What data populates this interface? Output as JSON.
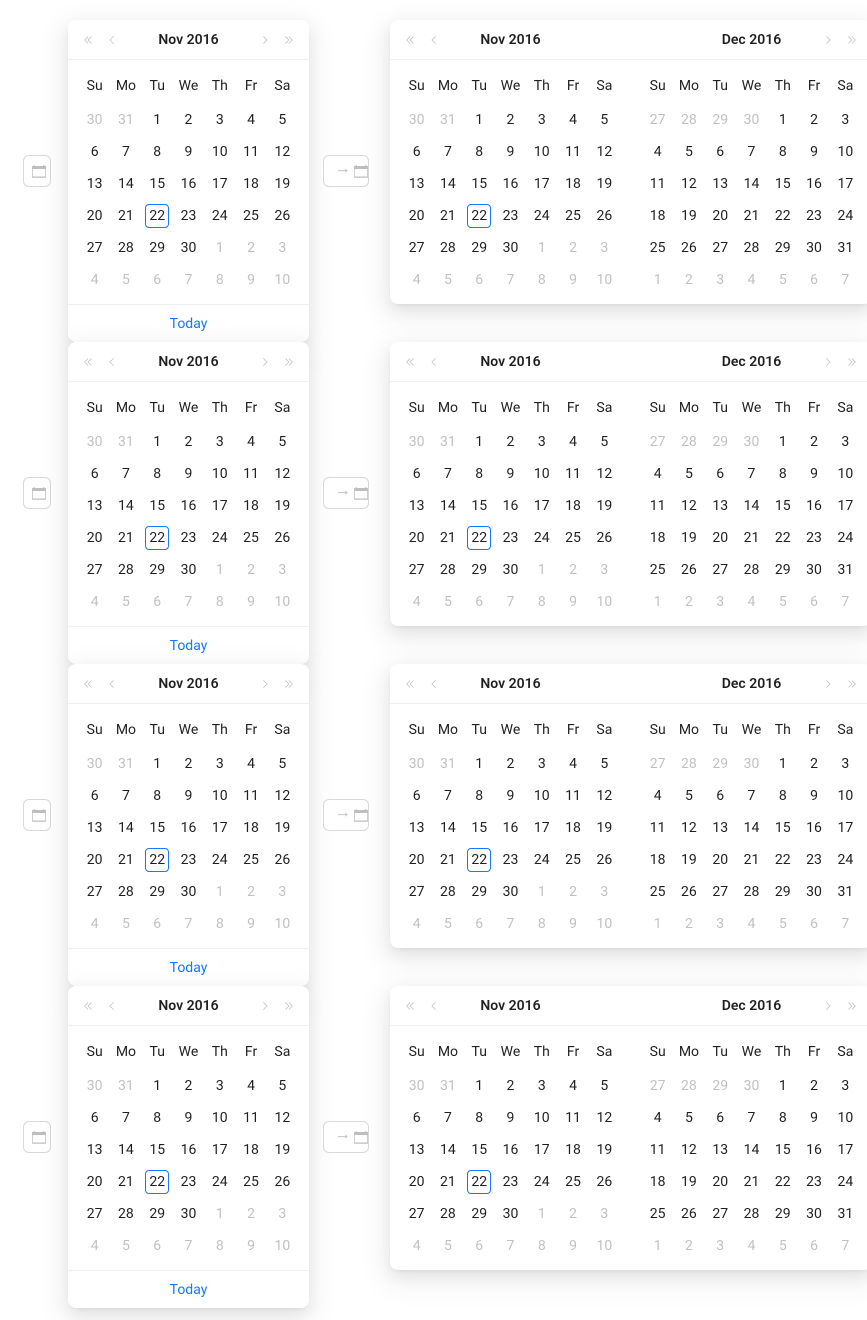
{
  "weekdayLabels": [
    "Su",
    "Mo",
    "Tu",
    "We",
    "Th",
    "Fr",
    "Sa"
  ],
  "footerLink": "Today",
  "colors": {
    "accent": "#1677ff"
  },
  "panels": {
    "nov2016": {
      "title": "Nov 2016",
      "weeks": [
        [
          {
            "d": 30,
            "out": true
          },
          {
            "d": 31,
            "out": true
          },
          {
            "d": 1
          },
          {
            "d": 2
          },
          {
            "d": 3
          },
          {
            "d": 4
          },
          {
            "d": 5
          }
        ],
        [
          {
            "d": 6
          },
          {
            "d": 7
          },
          {
            "d": 8
          },
          {
            "d": 9
          },
          {
            "d": 10
          },
          {
            "d": 11
          },
          {
            "d": 12
          }
        ],
        [
          {
            "d": 13
          },
          {
            "d": 14
          },
          {
            "d": 15
          },
          {
            "d": 16
          },
          {
            "d": 17
          },
          {
            "d": 18
          },
          {
            "d": 19
          }
        ],
        [
          {
            "d": 20
          },
          {
            "d": 21
          },
          {
            "d": 22,
            "today": true
          },
          {
            "d": 23
          },
          {
            "d": 24
          },
          {
            "d": 25
          },
          {
            "d": 26
          }
        ],
        [
          {
            "d": 27
          },
          {
            "d": 28
          },
          {
            "d": 29
          },
          {
            "d": 30
          },
          {
            "d": 1,
            "out": true
          },
          {
            "d": 2,
            "out": true
          },
          {
            "d": 3,
            "out": true
          }
        ],
        [
          {
            "d": 4,
            "out": true
          },
          {
            "d": 5,
            "out": true
          },
          {
            "d": 6,
            "out": true
          },
          {
            "d": 7,
            "out": true
          },
          {
            "d": 8,
            "out": true
          },
          {
            "d": 9,
            "out": true
          },
          {
            "d": 10,
            "out": true
          }
        ]
      ]
    },
    "dec2016": {
      "title": "Dec 2016",
      "weeks": [
        [
          {
            "d": 27,
            "out": true
          },
          {
            "d": 28,
            "out": true
          },
          {
            "d": 29,
            "out": true
          },
          {
            "d": 30,
            "out": true
          },
          {
            "d": 1
          },
          {
            "d": 2
          },
          {
            "d": 3
          }
        ],
        [
          {
            "d": 4
          },
          {
            "d": 5
          },
          {
            "d": 6
          },
          {
            "d": 7
          },
          {
            "d": 8
          },
          {
            "d": 9
          },
          {
            "d": 10
          }
        ],
        [
          {
            "d": 11
          },
          {
            "d": 12
          },
          {
            "d": 13
          },
          {
            "d": 14
          },
          {
            "d": 15
          },
          {
            "d": 16
          },
          {
            "d": 17
          }
        ],
        [
          {
            "d": 18
          },
          {
            "d": 19
          },
          {
            "d": 20
          },
          {
            "d": 21
          },
          {
            "d": 22
          },
          {
            "d": 23
          },
          {
            "d": 24
          }
        ],
        [
          {
            "d": 25
          },
          {
            "d": 26
          },
          {
            "d": 27
          },
          {
            "d": 28
          },
          {
            "d": 29
          },
          {
            "d": 30
          },
          {
            "d": 31
          }
        ],
        [
          {
            "d": 1,
            "out": true
          },
          {
            "d": 2,
            "out": true
          },
          {
            "d": 3,
            "out": true
          },
          {
            "d": 4,
            "out": true
          },
          {
            "d": 5,
            "out": true
          },
          {
            "d": 6,
            "out": true
          },
          {
            "d": 7,
            "out": true
          }
        ]
      ]
    }
  },
  "left": [
    {
      "panel": "nov2016"
    },
    {
      "panel": "nov2016"
    },
    {
      "panel": "nov2016"
    },
    {
      "panel": "nov2016"
    }
  ],
  "right": [
    {
      "panels": [
        "nov2016",
        "dec2016"
      ]
    },
    {
      "panels": [
        "nov2016",
        "dec2016"
      ]
    },
    {
      "panels": [
        "nov2016",
        "dec2016"
      ]
    },
    {
      "panels": [
        "nov2016",
        "dec2016"
      ]
    }
  ]
}
